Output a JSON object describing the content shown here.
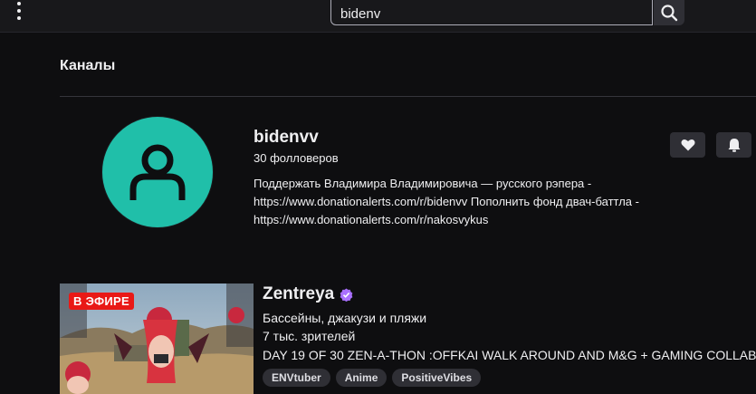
{
  "search": {
    "value": "bidenv"
  },
  "section": {
    "title": "Каналы"
  },
  "channel": {
    "name": "bidenvv",
    "followers": "30 фолловеров",
    "description": "Поддержать Владимира Владимировича — русского рэпера - https://www.donationalerts.com/r/bidenvv Пополнить фонд двач-баттла - https://www.donationalerts.com/r/nakosvykus",
    "avatar_color": "#20bfa9"
  },
  "stream": {
    "live_label": "В ЭФИРЕ",
    "name": "Zentreya",
    "category": "Бассейны, джакузи и пляжи",
    "viewers": "7 тыс. зрителей",
    "title": "DAY 19 OF 30 ZEN-A-THON :OFFKAI WALK AROUND AND M&G + GAMING COLLAB",
    "tags": [
      "ENVtuber",
      "Anime",
      "PositiveVibes"
    ],
    "verified_color": "#a970ff"
  },
  "icons": {
    "menu": "kebab-menu-icon",
    "search": "search-icon",
    "follow": "heart-icon",
    "notify": "bell-icon",
    "verified": "verified-badge-icon",
    "avatar": "user-silhouette-icon"
  }
}
